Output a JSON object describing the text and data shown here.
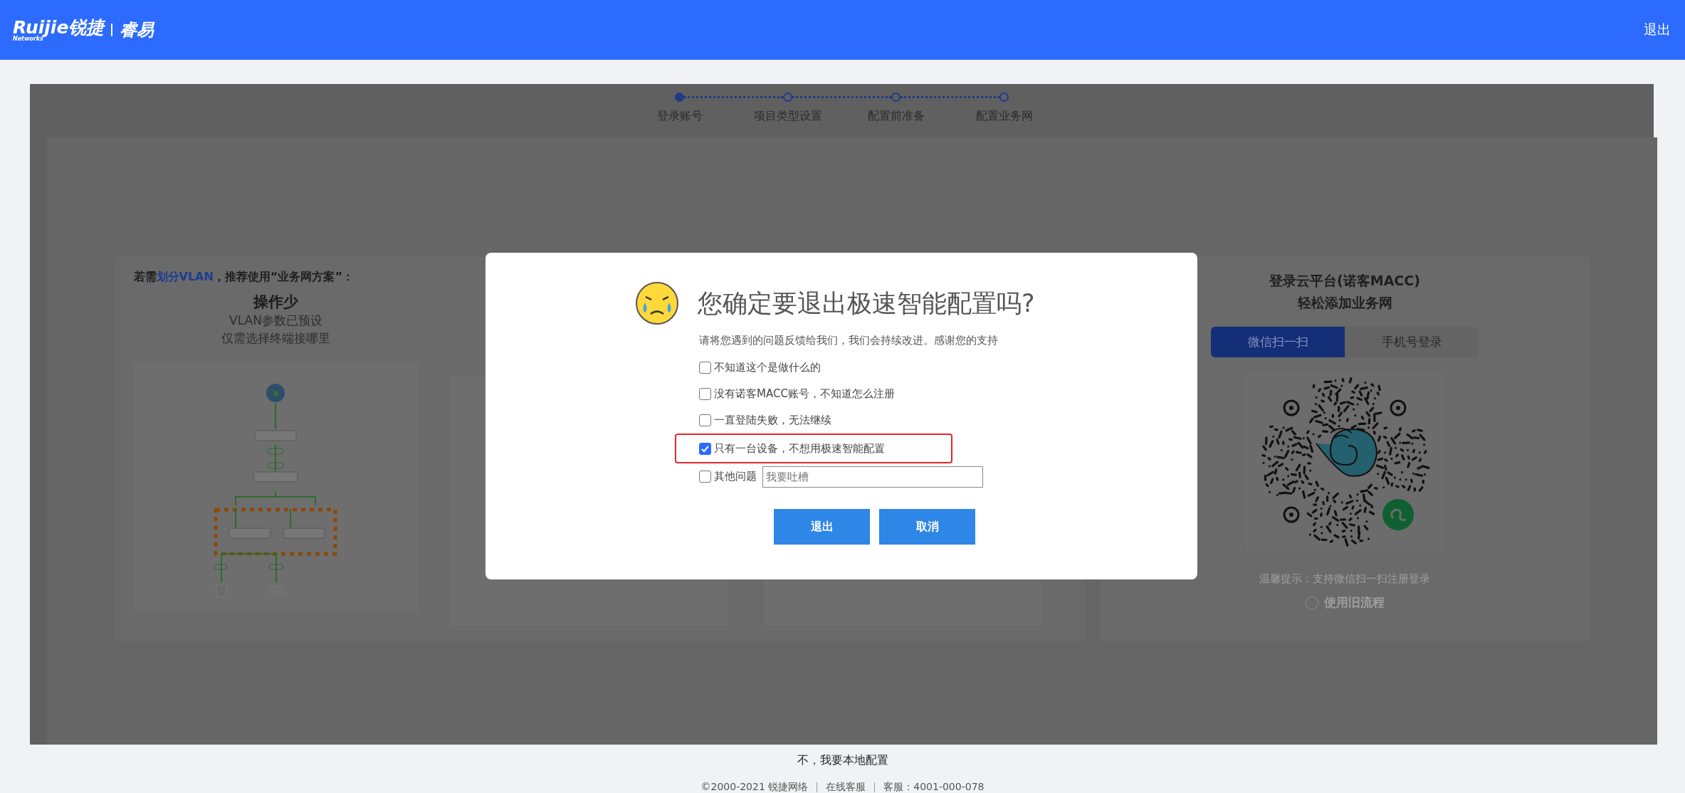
{
  "header": {
    "brand": "Ruijie锐捷",
    "brand_sub": "Networks",
    "product": "睿易",
    "logout": "退出"
  },
  "steps": [
    {
      "label": "登录账号",
      "completed": true
    },
    {
      "label": "项目类型设置",
      "completed": false
    },
    {
      "label": "配置前准备",
      "completed": false
    },
    {
      "label": "配置业务网",
      "completed": false
    }
  ],
  "plan_card": {
    "heading": [
      {
        "text": "若需",
        "highlight": false
      },
      {
        "text": "划分VLAN",
        "highlight": true
      },
      {
        "text": "，推荐使用“业务网方案”：",
        "highlight": false
      }
    ],
    "title": "操作少",
    "lines": [
      "VLAN参数已预设",
      "仅需选择终端接哪里"
    ]
  },
  "cloud_card": {
    "title_lines": [
      "登录云平台(诺客MACC)",
      "轻松添加业务网"
    ],
    "tabs": [
      {
        "label": "微信扫一扫",
        "selected": true
      },
      {
        "label": "手机号登录",
        "selected": false
      }
    ],
    "hint": "温馨提示：支持微信扫一扫注册登录",
    "old_flow": {
      "label": "使用旧流程",
      "checked": false
    }
  },
  "modal": {
    "title": "您确定要退出极速智能配置吗?",
    "intro": "请将您遇到的问题反馈给我们，我们会持续改进。感谢您的支持",
    "options": [
      {
        "label": "不知道这个是做什么的",
        "checked": false,
        "highlighted": false
      },
      {
        "label": "没有诺客MACC账号，不知道怎么注册",
        "checked": false,
        "highlighted": false
      },
      {
        "label": "一直登陆失败，无法继续",
        "checked": false,
        "highlighted": false
      },
      {
        "label": "只有一台设备，不想用极速智能配置",
        "checked": true,
        "highlighted": true
      }
    ],
    "other": {
      "label": "其他问题",
      "checked": false,
      "placeholder": "我要吐槽"
    },
    "buttons": [
      "退出",
      "取消"
    ]
  },
  "local_link": "不，我要本地配置",
  "footer": [
    "©2000-2021 锐捷网络",
    "在线客服",
    "客服：4001-000-078"
  ]
}
